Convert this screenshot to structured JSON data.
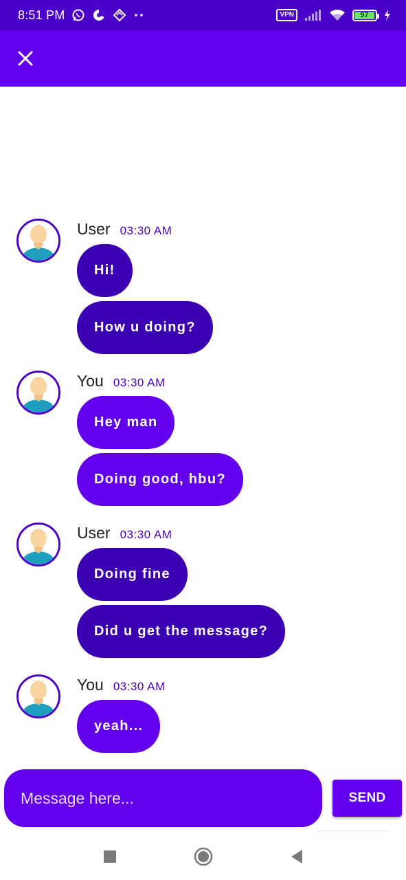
{
  "status_bar": {
    "time": "8:51 PM",
    "vpn_label": "VPN",
    "battery_level": "97",
    "icons": [
      "whatsapp-icon",
      "data-saver-icon",
      "app-icon",
      "more-notifications-icon",
      "signal-icon",
      "wifi-icon",
      "battery-icon",
      "charging-icon"
    ]
  },
  "app_bar": {
    "close_icon": "close-icon",
    "background": "#6200ee"
  },
  "messages": [
    {
      "sender": "User",
      "time": "03:30 AM",
      "side": "other",
      "texts": [
        "Hi!",
        "How u doing?"
      ]
    },
    {
      "sender": "You",
      "time": "03:30 AM",
      "side": "mine",
      "texts": [
        "Hey man",
        "Doing good, hbu?"
      ]
    },
    {
      "sender": "User",
      "time": "03:30 AM",
      "side": "other",
      "texts": [
        "Doing fine",
        "Did u get the message?"
      ]
    },
    {
      "sender": "You",
      "time": "03:30 AM",
      "side": "mine",
      "texts": [
        "yeah..."
      ]
    }
  ],
  "composer": {
    "placeholder": "Message here...",
    "value": "",
    "send_label": "SEND"
  },
  "nav_bar": {
    "icons": [
      "recents-square-icon",
      "home-circle-icon",
      "back-triangle-icon"
    ]
  },
  "colors": {
    "status_bar": "#4a00c8",
    "accent": "#6200ee",
    "bubble_other": "#3b00b2",
    "bubble_mine": "#6200ee",
    "timestamp": "#4a00c8"
  }
}
